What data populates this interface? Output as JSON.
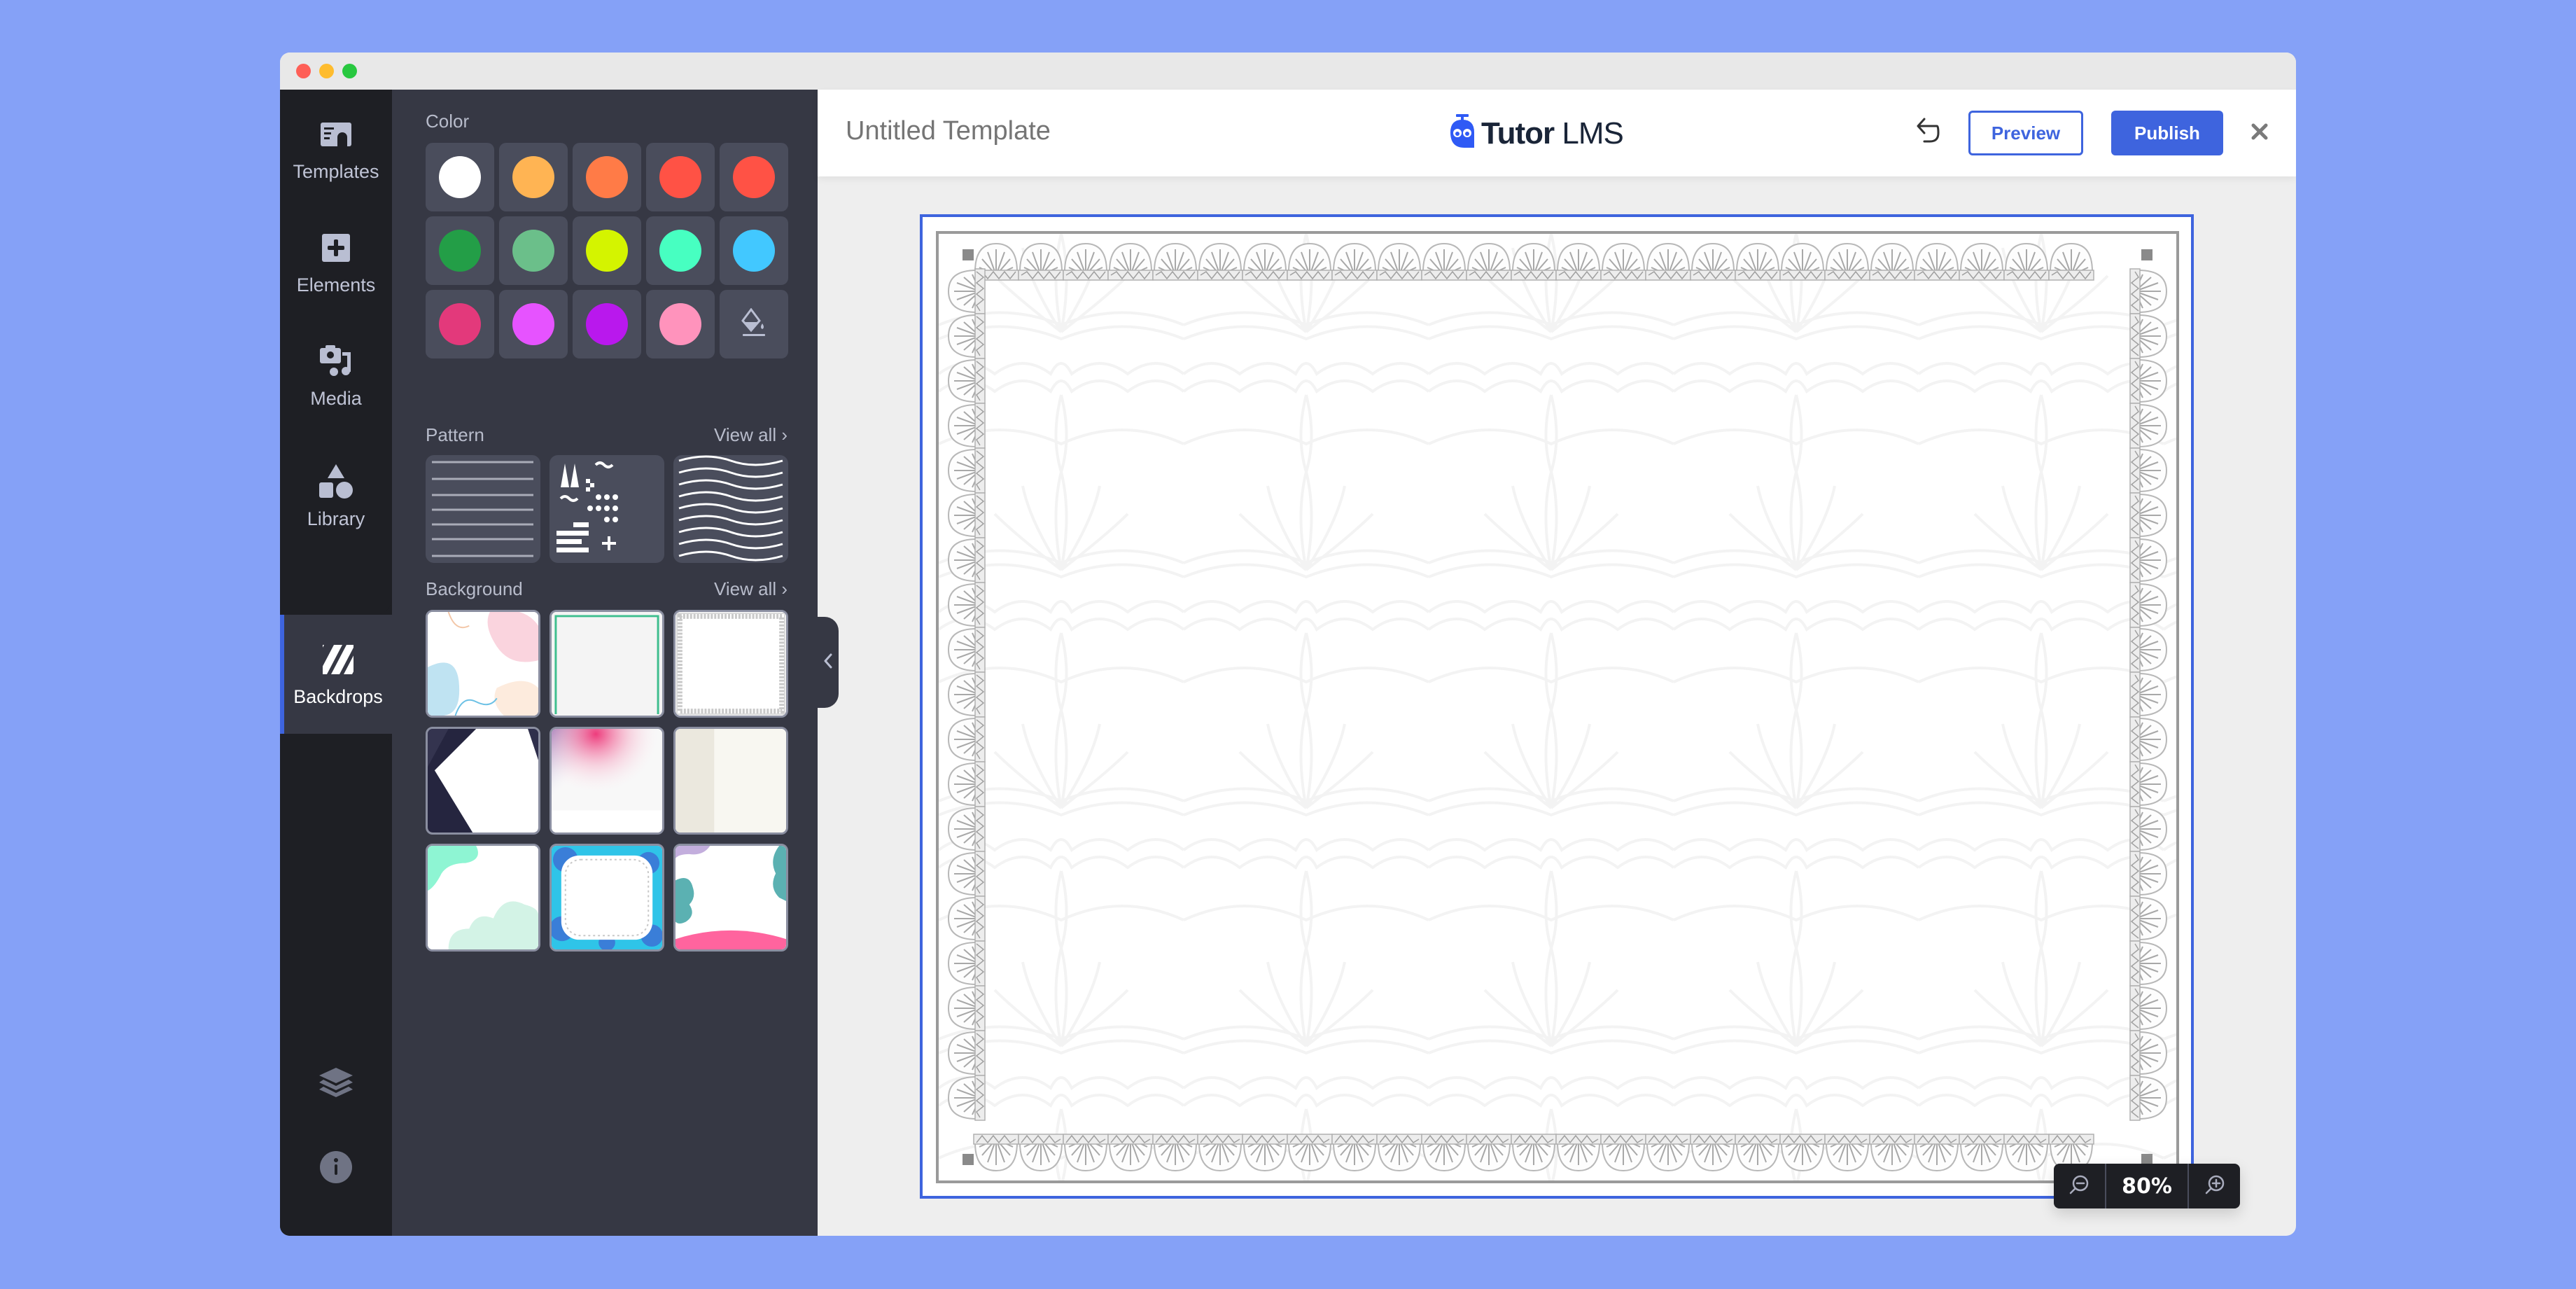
{
  "window": {
    "traffic_lights": [
      "close",
      "minimize",
      "maximize"
    ]
  },
  "rail": {
    "items": [
      {
        "id": "templates",
        "label": "Templates",
        "icon": "certificate-icon",
        "active": false
      },
      {
        "id": "elements",
        "label": "Elements",
        "icon": "plus-square-icon",
        "active": false
      },
      {
        "id": "media",
        "label": "Media",
        "icon": "camera-music-icon",
        "active": false
      },
      {
        "id": "library",
        "label": "Library",
        "icon": "shapes-icon",
        "active": false
      },
      {
        "id": "backdrops",
        "label": "Backdrops",
        "icon": "stripes-icon",
        "active": true
      }
    ],
    "bottom": [
      {
        "id": "layers",
        "icon": "layers-icon"
      },
      {
        "id": "info",
        "icon": "info-icon"
      }
    ]
  },
  "panel": {
    "color_section": {
      "title": "Color",
      "swatches": [
        "#FFFFFF",
        "#FFB453",
        "#FF7B47",
        "#FF5245",
        "#FF5245",
        "#239E47",
        "#6BBF8A",
        "#D4F400",
        "#47FFC1",
        "#42C8FF",
        "#E3397B",
        "#E653FF",
        "#B918ED",
        "#FF93BC"
      ],
      "custom_icon": "paint-bucket-icon"
    },
    "pattern_section": {
      "title": "Pattern",
      "view_all": "View all ›",
      "items": [
        "horizontal-lines",
        "geometric-shapes",
        "waves"
      ]
    },
    "background_section": {
      "title": "Background",
      "view_all": "View all ›",
      "items": [
        "pastel-blobs",
        "green-frame",
        "lace-frame",
        "dark-hexagon",
        "pink-gradient",
        "cream-stripe",
        "mint-blobs",
        "blue-floral-frame",
        "pink-teal-waves"
      ]
    }
  },
  "header": {
    "title": "Untitled Template",
    "logo_text_bold": "Tutor",
    "logo_text_light": " LMS",
    "preview_label": "Preview",
    "publish_label": "Publish"
  },
  "zoom": {
    "value": "80%"
  },
  "colors": {
    "accent": "#3E64DE",
    "rail_bg": "#1E1F24",
    "panel_bg": "#363844",
    "page_bg": "#85A1F7"
  }
}
